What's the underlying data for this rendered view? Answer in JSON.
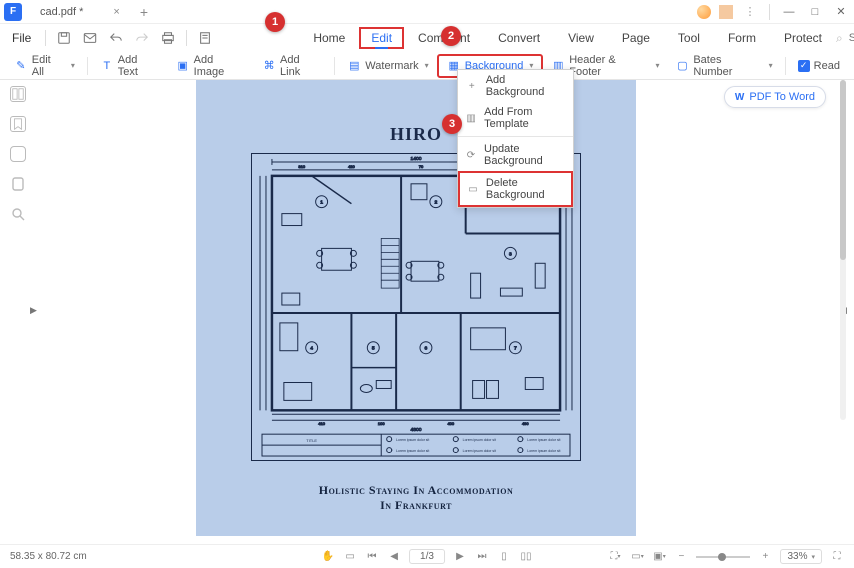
{
  "titlebar": {
    "tab": "cad.pdf *"
  },
  "file_btn": "File",
  "menu": {
    "home": "Home",
    "edit": "Edit",
    "comment": "Comment",
    "convert": "Convert",
    "view": "View",
    "page": "Page",
    "tool": "Tool",
    "form": "Form",
    "protect": "Protect"
  },
  "search_placeholder": "Search Tools",
  "ribbon": {
    "edit_all": "Edit All",
    "add_text": "Add Text",
    "add_image": "Add Image",
    "add_link": "Add Link",
    "watermark": "Watermark",
    "background": "Background",
    "header_footer": "Header & Footer",
    "bates_number": "Bates Number",
    "read": "Read"
  },
  "dropdown": {
    "add_bg": "Add Background",
    "add_tpl": "Add From Template",
    "update_bg": "Update Background",
    "delete_bg": "Delete Background"
  },
  "callouts": {
    "c1": "1",
    "c2": "2",
    "c3": "3"
  },
  "pdf2word": "PDF To Word",
  "document": {
    "heading": "HIRO",
    "sub1": "Holistic Staying In Accommodation",
    "sub2": "In Frankfurt",
    "title_label": "TITLE",
    "lorem": "Lorem ipsum dolor sit"
  },
  "status": {
    "dims": "58.35 x 80.72 cm",
    "page": "1/3",
    "zoom": "33%"
  }
}
